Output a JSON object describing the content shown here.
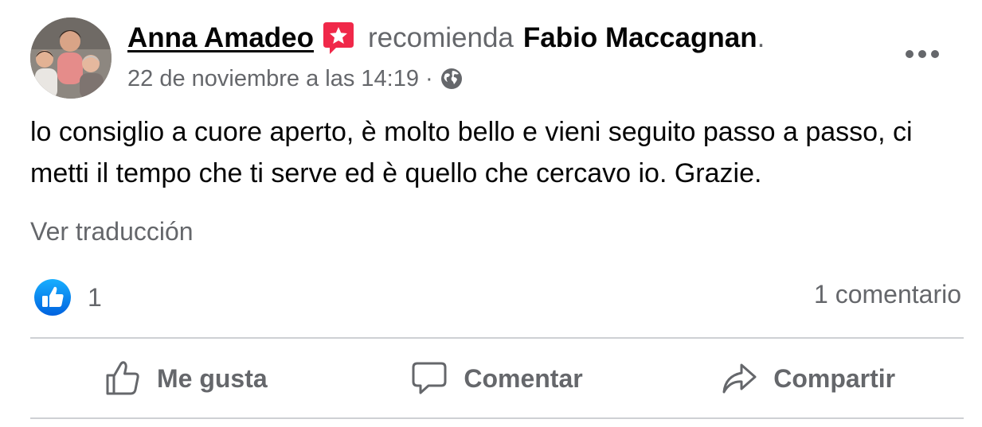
{
  "post": {
    "author": "Anna Amadeo",
    "verb": "recomienda",
    "target": "Fabio Maccagnan",
    "target_suffix": ".",
    "timestamp": "22 de noviembre a las 14:19",
    "meta_separator": "·",
    "privacy_icon": "globe-icon",
    "recommend_icon": "recommendation-star-icon",
    "body": "lo consiglio a cuore aperto, è molto bello e vieni seguito passo a passo, ci metti il tempo che ti serve ed è quello che cercavo io. Grazie.",
    "translate_link": "Ver traducción"
  },
  "stats": {
    "reaction_count": "1",
    "reaction_icon": "like-reaction-icon",
    "comments": "1 comentario"
  },
  "actions": {
    "like_label": "Me gusta",
    "comment_label": "Comentar",
    "share_label": "Compartir"
  },
  "colors": {
    "text_primary": "#050505",
    "text_secondary": "#65676b",
    "like_blue": "#1877f2",
    "recommend_red": "#f02849",
    "divider": "#ced0d4"
  }
}
